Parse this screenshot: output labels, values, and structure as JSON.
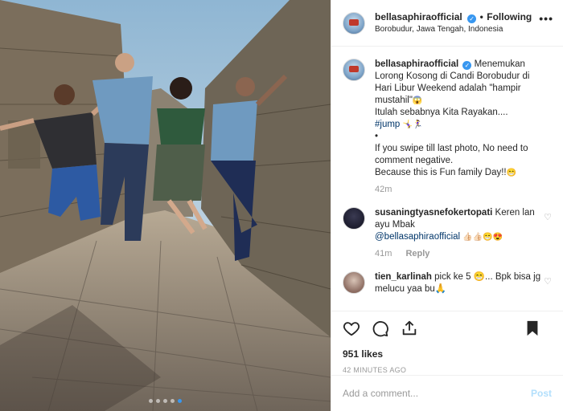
{
  "post": {
    "username": "bellasaphiraofficial",
    "follow_status": "Following",
    "separator": "•",
    "location": "Borobudur, Jawa Tengah, Indonesia",
    "more_icon": "ellipsis-icon"
  },
  "caption": {
    "username": "bellasaphiraofficial",
    "line1": "Menemukan Lorong Kosong di Candi Borobudur di Hari Libur Weekend adalah \"hampir mustahil\"",
    "emoji1": "😱",
    "line2": "Itulah sebabnya Kita Rayakan....",
    "hashtag": "#jump",
    "emoji2": "🤸‍♀️🏃‍♀️",
    "bullet": "•",
    "line3": "If you swipe till last photo, No need to comment negative.",
    "line4": "Because this is Fun family Day!!",
    "emoji3": "😁",
    "time": "42m"
  },
  "comments": [
    {
      "username": "susaningtyasnefokertopati",
      "text": "Keren lan ayu Mbak",
      "mention": "@bellasaphiraofficial",
      "emoji": "👍🏻👍🏻😁😍",
      "time": "41m",
      "reply": "Reply"
    },
    {
      "username": "tien_karlinah",
      "text": "pick ke 5 😁... Bpk bisa jg melucu yaa bu🙏",
      "time": "",
      "reply": ""
    }
  ],
  "actions": {
    "likes": "951 likes",
    "posted_ago": "42 MINUTES AGO"
  },
  "add_comment": {
    "placeholder": "Add a comment...",
    "post_label": "Post"
  },
  "carousel": {
    "count": 5,
    "active_index": 4
  },
  "colors": {
    "accent": "#3897f0",
    "post_disabled": "#b2dffc",
    "hashtag": "#003569"
  }
}
